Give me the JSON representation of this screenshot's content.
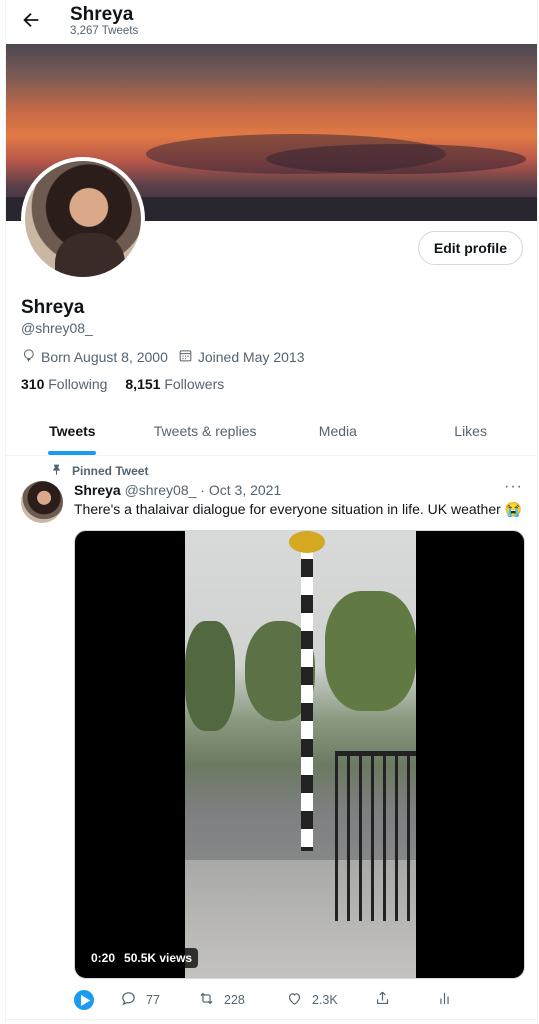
{
  "header": {
    "back_icon": "arrow-left-icon",
    "name": "Shreya",
    "tweet_count": "3,267 Tweets"
  },
  "profile": {
    "edit_label": "Edit profile",
    "name": "Shreya",
    "handle": "@shrey08_",
    "born": "Born August 8, 2000",
    "joined": "Joined May 2013",
    "following_count": "310",
    "following_label": "Following",
    "followers_count": "8,151",
    "followers_label": "Followers"
  },
  "tabs": [
    {
      "label": "Tweets",
      "active": true
    },
    {
      "label": "Tweets & replies",
      "active": false
    },
    {
      "label": "Media",
      "active": false
    },
    {
      "label": "Likes",
      "active": false
    }
  ],
  "tweet": {
    "pinned_label": "Pinned Tweet",
    "name": "Shreya",
    "handle": "@shrey08_",
    "separator": "·",
    "date": "Oct 3, 2021",
    "more": "···",
    "text": "There's a thalaivar dialogue for everyone situation in life. UK weather 😭",
    "video_duration": "0:20",
    "video_views": "50.5K views",
    "replies": "77",
    "retweets": "228",
    "likes": "2.3K"
  },
  "colors": {
    "accent": "#1d9bf0",
    "text": "#0f1419",
    "secondary": "#536471"
  }
}
